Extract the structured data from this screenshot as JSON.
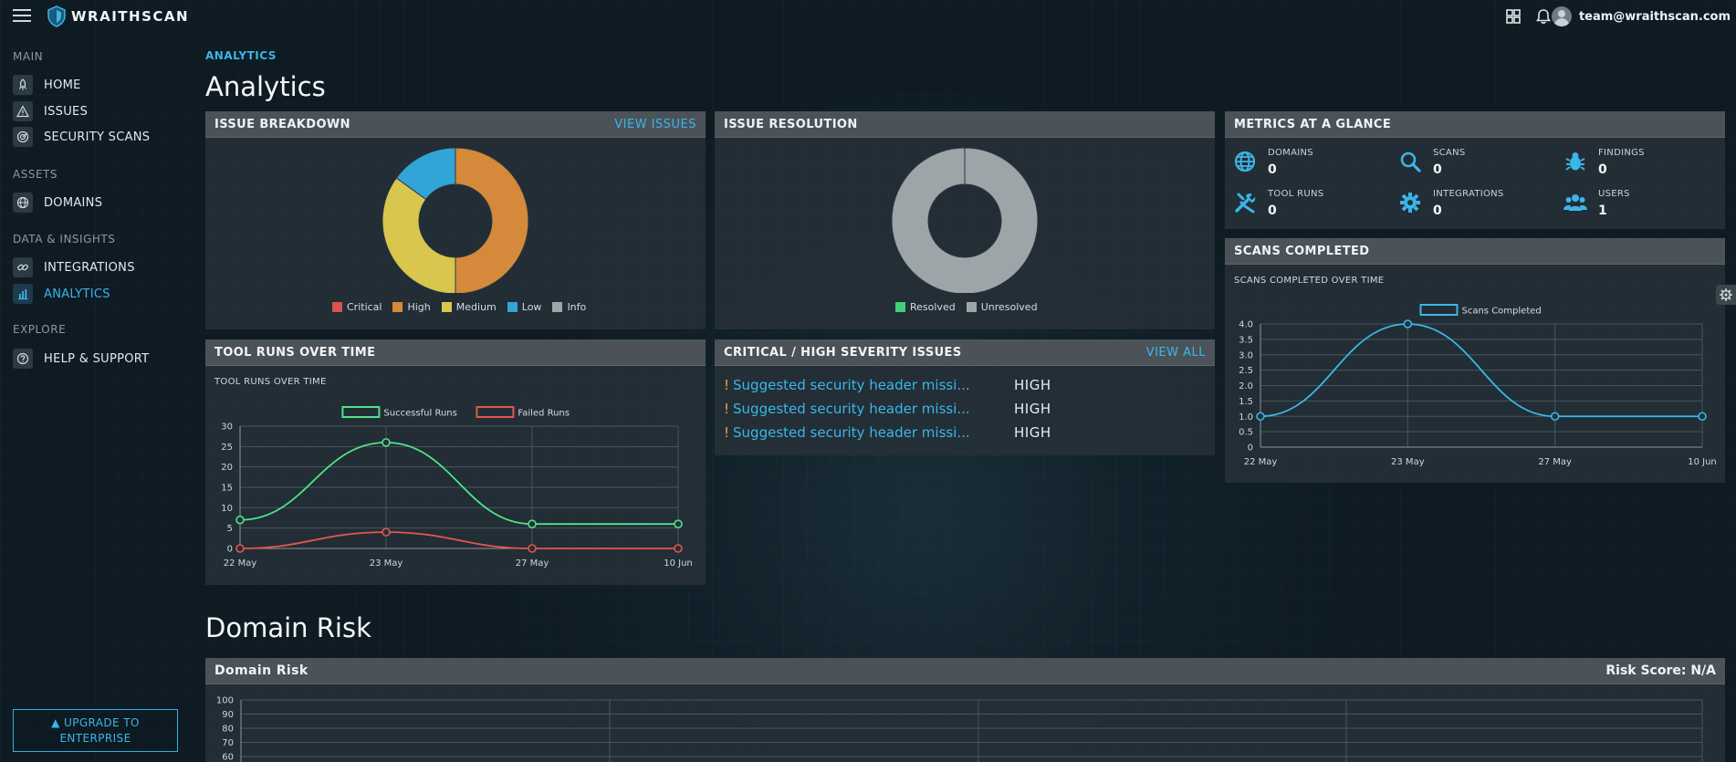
{
  "app": {
    "brand": "WRAITHSCAN",
    "user_email": "team@wraithscan.com"
  },
  "sidebar": {
    "sections": [
      {
        "label": "MAIN",
        "items": [
          {
            "label": "HOME",
            "icon": "rocket-icon"
          },
          {
            "label": "ISSUES",
            "icon": "warning-icon"
          },
          {
            "label": "SECURITY SCANS",
            "icon": "radar-icon"
          }
        ]
      },
      {
        "label": "ASSETS",
        "items": [
          {
            "label": "DOMAINS",
            "icon": "globe-icon"
          }
        ]
      },
      {
        "label": "DATA & INSIGHTS",
        "items": [
          {
            "label": "INTEGRATIONS",
            "icon": "link-icon"
          },
          {
            "label": "ANALYTICS",
            "icon": "bar-chart-icon",
            "active": true
          }
        ]
      },
      {
        "label": "EXPLORE",
        "items": [
          {
            "label": "HELP & SUPPORT",
            "icon": "question-icon"
          }
        ]
      }
    ],
    "upgrade": {
      "line1": "UPGRADE TO",
      "line2": "ENTERPRISE"
    }
  },
  "page": {
    "breadcrumb": "ANALYTICS",
    "title": "Analytics",
    "section_title": "Domain Risk"
  },
  "panels": {
    "issue_breakdown": {
      "title": "ISSUE BREAKDOWN",
      "link": "VIEW ISSUES"
    },
    "issue_resolution": {
      "title": "ISSUE RESOLUTION"
    },
    "metrics": {
      "title": "METRICS AT A GLANCE",
      "items": [
        {
          "label": "DOMAINS",
          "value": "0",
          "icon": "globe-icon"
        },
        {
          "label": "SCANS",
          "value": "0",
          "icon": "search-icon"
        },
        {
          "label": "FINDINGS",
          "value": "0",
          "icon": "bug-icon"
        },
        {
          "label": "TOOL RUNS",
          "value": "0",
          "icon": "tools-icon"
        },
        {
          "label": "INTEGRATIONS",
          "value": "0",
          "icon": "gear-icon"
        },
        {
          "label": "USERS",
          "value": "1",
          "icon": "users-icon"
        }
      ]
    },
    "scans_completed": {
      "title": "SCANS COMPLETED",
      "subtitle": "SCANS COMPLETED OVER TIME"
    },
    "tool_runs": {
      "title": "TOOL RUNS OVER TIME",
      "subtitle": "TOOL RUNS OVER TIME"
    },
    "critical_issues": {
      "title": "CRITICAL / HIGH SEVERITY ISSUES",
      "link": "VIEW ALL",
      "rows": [
        {
          "title": "Suggested security header missi...",
          "severity": "HIGH"
        },
        {
          "title": "Suggested security header missi...",
          "severity": "HIGH"
        },
        {
          "title": "Suggested security header missi...",
          "severity": "HIGH"
        }
      ]
    },
    "domain_risk": {
      "title": "Domain Risk",
      "risk_score": "Risk Score: N/A"
    }
  },
  "chart_data": [
    {
      "type": "pie",
      "name": "issue-breakdown",
      "categories": [
        "Critical",
        "High",
        "Medium",
        "Low",
        "Info"
      ],
      "values": [
        0,
        50,
        35,
        15,
        0
      ],
      "colors": [
        "#d9534f",
        "#d48a3a",
        "#d8c64f",
        "#33a4d6",
        "#9ea5a9"
      ],
      "donut": true
    },
    {
      "type": "pie",
      "name": "issue-resolution",
      "categories": [
        "Resolved",
        "Unresolved"
      ],
      "values": [
        0,
        100
      ],
      "colors": [
        "#3fcf7a",
        "#9ea5a9"
      ],
      "donut": true
    },
    {
      "type": "line",
      "name": "tool-runs",
      "x": [
        "22 May",
        "23 May",
        "27 May",
        "10 Jun"
      ],
      "series": [
        {
          "name": "Successful Runs",
          "values": [
            7,
            26,
            6,
            6
          ],
          "color": "#4ee38a"
        },
        {
          "name": "Failed Runs",
          "values": [
            0,
            4,
            0,
            0
          ],
          "color": "#e2564f"
        }
      ],
      "ylim": [
        0,
        30
      ],
      "yticks": [
        0,
        5,
        10,
        15,
        20,
        25,
        30
      ],
      "legend": "top-center",
      "grid": true
    },
    {
      "type": "line",
      "name": "scans-completed",
      "x": [
        "22 May",
        "23 May",
        "27 May",
        "10 Jun"
      ],
      "series": [
        {
          "name": "Scans Completed",
          "values": [
            1,
            4,
            1,
            1
          ],
          "color": "#38b8ea"
        }
      ],
      "ylim": [
        0,
        4
      ],
      "yticks": [
        0,
        0.5,
        1.0,
        1.5,
        2.0,
        2.5,
        3.0,
        3.5,
        4.0
      ],
      "ytick_labels": [
        "0",
        "0.5",
        "1.0",
        "1.5",
        "2.0",
        "2.5",
        "3.0",
        "3.5",
        "4.0"
      ],
      "legend": "top-center",
      "grid": true
    },
    {
      "type": "line",
      "name": "domain-risk",
      "series": [],
      "yticks": [
        60,
        70,
        80,
        90,
        100
      ],
      "ylim": [
        0,
        100
      ],
      "grid": true
    }
  ]
}
